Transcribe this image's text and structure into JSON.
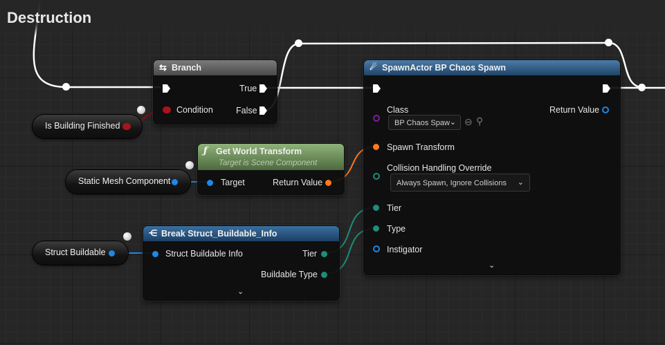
{
  "graph_title": "Destruction",
  "nodes": {
    "branch": {
      "title": "Branch",
      "pins": {
        "condition": "Condition",
        "true": "True",
        "false": "False"
      }
    },
    "get_world_transform": {
      "title": "Get World Transform",
      "subtitle": "Target is Scene Component",
      "pins": {
        "target": "Target",
        "return_value": "Return Value"
      }
    },
    "break_struct": {
      "title": "Break Struct_Buildable_Info",
      "pins": {
        "input": "Struct Buildable Info",
        "tier": "Tier",
        "buildable_type": "Buildable Type"
      }
    },
    "spawn_actor": {
      "title": "SpawnActor BP Chaos Spawn",
      "pins": {
        "class": "Class",
        "class_value": "BP Chaos Spaw",
        "return_value": "Return Value",
        "spawn_transform": "Spawn Transform",
        "collision_handling": "Collision Handling Override",
        "collision_value": "Always Spawn, Ignore Collisions",
        "tier": "Tier",
        "type": "Type",
        "instigator": "Instigator"
      }
    }
  },
  "variables": {
    "is_building_finished": "Is Building Finished",
    "static_mesh_component": "Static Mesh Component",
    "struct_buildable": "Struct Buildable"
  },
  "icons": {
    "branch": "branch-icon",
    "function": "function-icon",
    "break": "break-struct-icon",
    "spawn": "spawn-actor-icon",
    "expand": "chevron-down-icon",
    "browse": "arrow-left-circle-icon",
    "search": "search-icon"
  },
  "colors": {
    "exec": "#ffffff",
    "bool": "#9c0a0a",
    "object": "#1e88e5",
    "struct_transform": "#ff7a1a",
    "struct_teal": "#1f8c7a",
    "class": "#7b1fa2",
    "branch_header": "#6d6d6d",
    "pure_header": "#6f8f5a",
    "call_header": "#3d6c91"
  }
}
